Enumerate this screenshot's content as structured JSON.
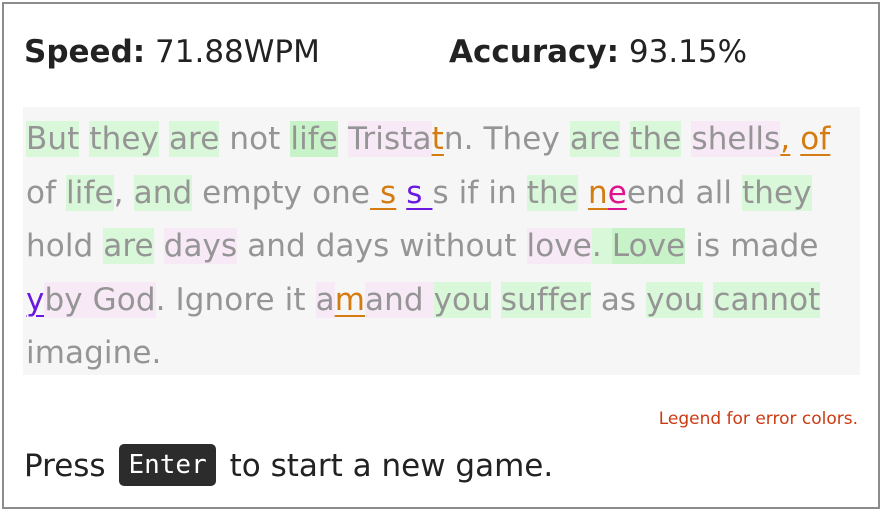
{
  "stats": {
    "speed_label": "Speed:",
    "speed_value": "71.88WPM",
    "accuracy_label": "Accuracy:",
    "accuracy_value": "93.15%"
  },
  "passage": {
    "segments": [
      {
        "t": "But",
        "c": "g"
      },
      {
        "t": " ",
        "c": ""
      },
      {
        "t": "they",
        "c": "g"
      },
      {
        "t": " ",
        "c": ""
      },
      {
        "t": "are",
        "c": "g"
      },
      {
        "t": " not ",
        "c": ""
      },
      {
        "t": "life",
        "c": "g2"
      },
      {
        "t": " ",
        "c": ""
      },
      {
        "t": "Trista",
        "c": "p"
      },
      {
        "t": "t",
        "c": "e-o"
      },
      {
        "t": "n. They ",
        "c": ""
      },
      {
        "t": "are",
        "c": "g"
      },
      {
        "t": " ",
        "c": ""
      },
      {
        "t": "the",
        "c": "g"
      },
      {
        "t": " ",
        "c": ""
      },
      {
        "t": "shells",
        "c": "p"
      },
      {
        "t": ",",
        "c": "e-o"
      },
      {
        "t": " ",
        "c": ""
      },
      {
        "t": "of ",
        "c": "e-o"
      },
      {
        "t": "of ",
        "c": ""
      },
      {
        "t": "life",
        "c": "g"
      },
      {
        "t": ", ",
        "c": ""
      },
      {
        "t": "and",
        "c": "g"
      },
      {
        "t": " empty one",
        "c": ""
      },
      {
        "t": " s",
        "c": "e-o"
      },
      {
        "t": " ",
        "c": ""
      },
      {
        "t": "s ",
        "c": "e-v"
      },
      {
        "t": "s if in ",
        "c": ""
      },
      {
        "t": "the",
        "c": "g"
      },
      {
        "t": " ",
        "c": ""
      },
      {
        "t": "n",
        "c": "e-o"
      },
      {
        "t": "e",
        "c": "e-m"
      },
      {
        "t": "end all",
        "c": ""
      },
      {
        "t": " ",
        "c": ""
      },
      {
        "t": "they",
        "c": "g"
      },
      {
        "t": " hold ",
        "c": ""
      },
      {
        "t": "are",
        "c": "g"
      },
      {
        "t": " ",
        "c": ""
      },
      {
        "t": "days",
        "c": "p"
      },
      {
        "t": " and days without ",
        "c": ""
      },
      {
        "t": "love",
        "c": "p"
      },
      {
        "t": ". ",
        "c": "g"
      },
      {
        "t": "Love",
        "c": "g2"
      },
      {
        "t": " is",
        "c": ""
      },
      {
        "t": " ",
        "c": ""
      },
      {
        "t": "made ",
        "c": ""
      },
      {
        "t": "y",
        "c": "e-v"
      },
      {
        "t": "by God",
        "c": "p"
      },
      {
        "t": ". Ignore it ",
        "c": ""
      },
      {
        "t": "a",
        "c": "p"
      },
      {
        "t": "m",
        "c": "e-o"
      },
      {
        "t": "and ",
        "c": "p"
      },
      {
        "t": "you",
        "c": "g"
      },
      {
        "t": " ",
        "c": ""
      },
      {
        "t": "suffer",
        "c": "g"
      },
      {
        "t": " as ",
        "c": ""
      },
      {
        "t": "you",
        "c": "g"
      },
      {
        "t": " ",
        "c": ""
      },
      {
        "t": "cannot",
        "c": "g"
      },
      {
        "t": " imagine.",
        "c": ""
      }
    ]
  },
  "legend_link": "Legend for error colors.",
  "prompt": {
    "before": "Press",
    "key": "Enter",
    "after": "to start a new game."
  }
}
